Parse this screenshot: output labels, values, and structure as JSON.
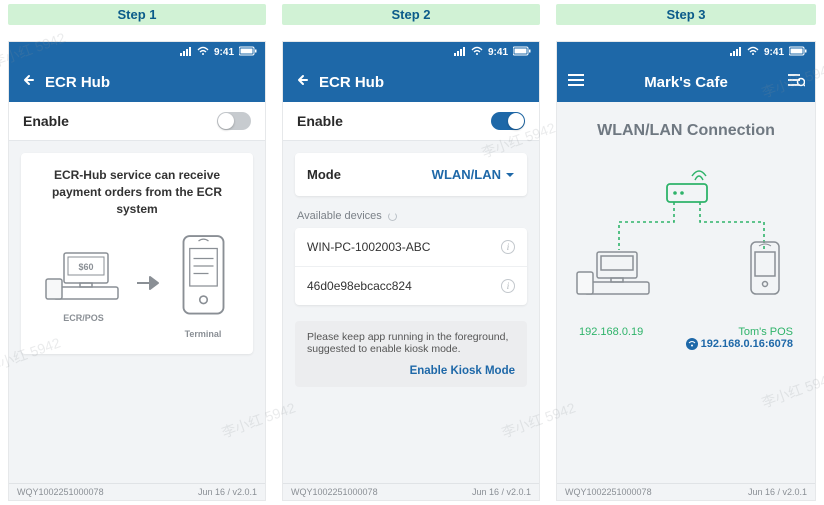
{
  "steps": [
    "Step 1",
    "Step 2",
    "Step 3"
  ],
  "status": {
    "time": "9:41"
  },
  "colors": {
    "primary": "#1e68a8",
    "green": "#2fb36a"
  },
  "footer": {
    "id": "WQY1002251000078",
    "version": "Jun 16 / v2.0.1"
  },
  "screen1": {
    "title": "ECR Hub",
    "enable_label": "Enable",
    "enabled": false,
    "card_line1": "ECR-Hub service can receive",
    "card_line2": "payment orders from the ECR system",
    "diagram": {
      "left_caption": "ECR/POS",
      "right_caption": "Terminal",
      "amount": "$60"
    }
  },
  "screen2": {
    "title": "ECR Hub",
    "enable_label": "Enable",
    "enabled": true,
    "mode_label": "Mode",
    "mode_value": "WLAN/LAN",
    "available_label": "Available devices",
    "devices": [
      {
        "name": "WIN-PC-1002003-ABC"
      },
      {
        "name": "46d0e98ebcacc824"
      }
    ],
    "hint_text": "Please keep app running in the foreground, suggested to enable kiosk mode.",
    "hint_action": "Enable Kiosk Mode"
  },
  "screen3": {
    "title": "Mark's Cafe",
    "heading": "WLAN/LAN Connection",
    "ecr_ip": "192.168.0.19",
    "pos_name": "Tom's POS",
    "pos_ip": "192.168.0.16:6078"
  },
  "watermark": "李小红 5942"
}
